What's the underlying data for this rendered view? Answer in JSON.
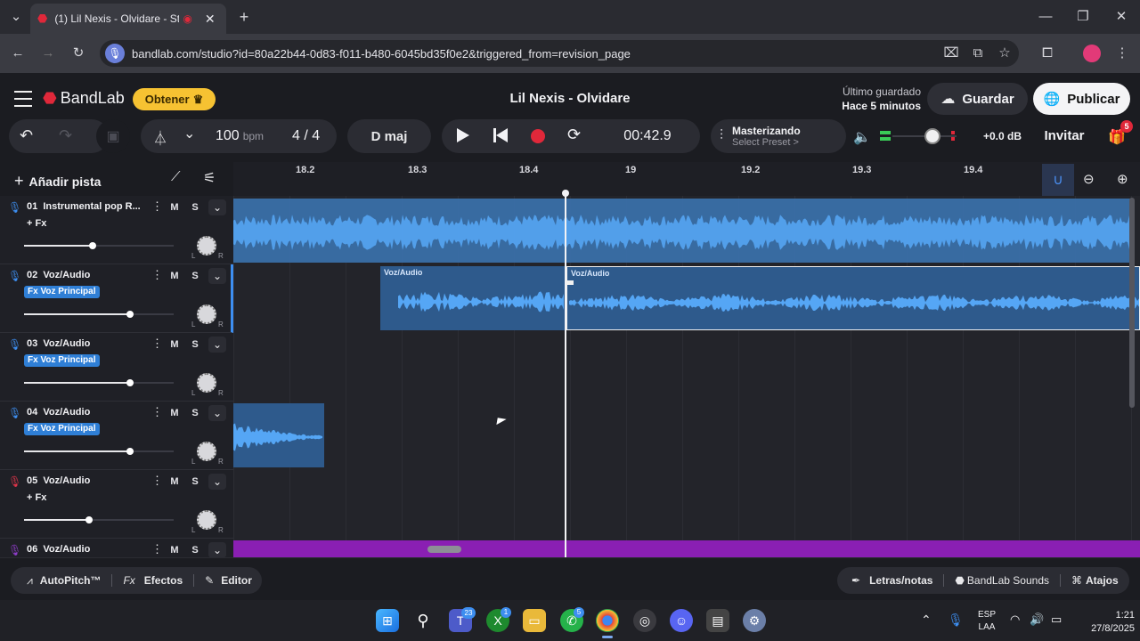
{
  "browser": {
    "tab_title": "(1) Lil Nexis - Olvidare - Stu",
    "url": "bandlab.com/studio?id=80a22b44-0d83-f011-b480-6045bd35f0e2&triggered_from=revision_page",
    "new_tab": "+"
  },
  "header": {
    "brand": "BandLab",
    "obtener": "Obtener",
    "project_title": "Lil Nexis - Olvidare",
    "saved_label": "Último guardado",
    "saved_time": "Hace 5 minutos",
    "save_button": "Guardar",
    "publish_button": "Publicar"
  },
  "toolbar": {
    "bpm_value": "100",
    "bpm_unit": "bpm",
    "time_signature": "4 / 4",
    "key": "D maj",
    "time": "00:42.9",
    "mastering_title": "Masterizando",
    "mastering_preset": "Select Preset >",
    "gain": "+0.0 dB",
    "invite": "Invitar",
    "gift_count": "5",
    "add_track": "Añadir pista"
  },
  "timeline": {
    "markers": [
      "18.2",
      "18.3",
      "18.4",
      "19",
      "19.2",
      "19.3",
      "19.4"
    ]
  },
  "tracks": [
    {
      "name": "01  Instrumental pop R...",
      "fx": "+ Fx",
      "fx_active": false,
      "mic_color": "#3d8ef0"
    },
    {
      "name": "02  Voz/Audio",
      "fx": "Fx Voz Principal",
      "fx_active": true,
      "mic_color": "#3d8ef0"
    },
    {
      "name": "03  Voz/Audio",
      "fx": "Fx Voz Principal",
      "fx_active": true,
      "mic_color": "#3d8ef0"
    },
    {
      "name": "04  Voz/Audio",
      "fx": "Fx Voz Principal",
      "fx_active": true,
      "mic_color": "#3d8ef0"
    },
    {
      "name": "05  Voz/Audio",
      "fx": "+ Fx",
      "fx_active": false,
      "mic_color": "#e0344a"
    },
    {
      "name": "06  Voz/Audio",
      "fx": "",
      "fx_active": false,
      "mic_color": "#8e3cc9"
    }
  ],
  "track_controls": {
    "mute": "M",
    "solo": "S",
    "left": "L",
    "right": "R"
  },
  "clips": {
    "voz_label_1": "Voz/Audio",
    "voz_label_2": "Voz/Audio"
  },
  "bottom": {
    "autopitch": "AutoPitch™",
    "effects": "Efectos",
    "fx_prefix": "Fx",
    "editor": "Editor",
    "lyrics": "Letras/notas",
    "sounds": "BandLab Sounds",
    "shortcuts": "Atajos"
  },
  "taskbar": {
    "lang_top": "ESP",
    "lang_bottom": "LAA",
    "clock_time": "1:21",
    "clock_date": "27/8/2025",
    "badge_teams": "23",
    "badge_xbox": "1",
    "badge_whatsapp": "5"
  },
  "colors": {
    "accent_blue": "#3d8ef0",
    "clip_blue": "#3a6fa8",
    "wave_blue": "#55a6f5",
    "record_red": "#e0283a",
    "purple": "#8a1fb3",
    "obtener_yellow": "#f6c232"
  }
}
